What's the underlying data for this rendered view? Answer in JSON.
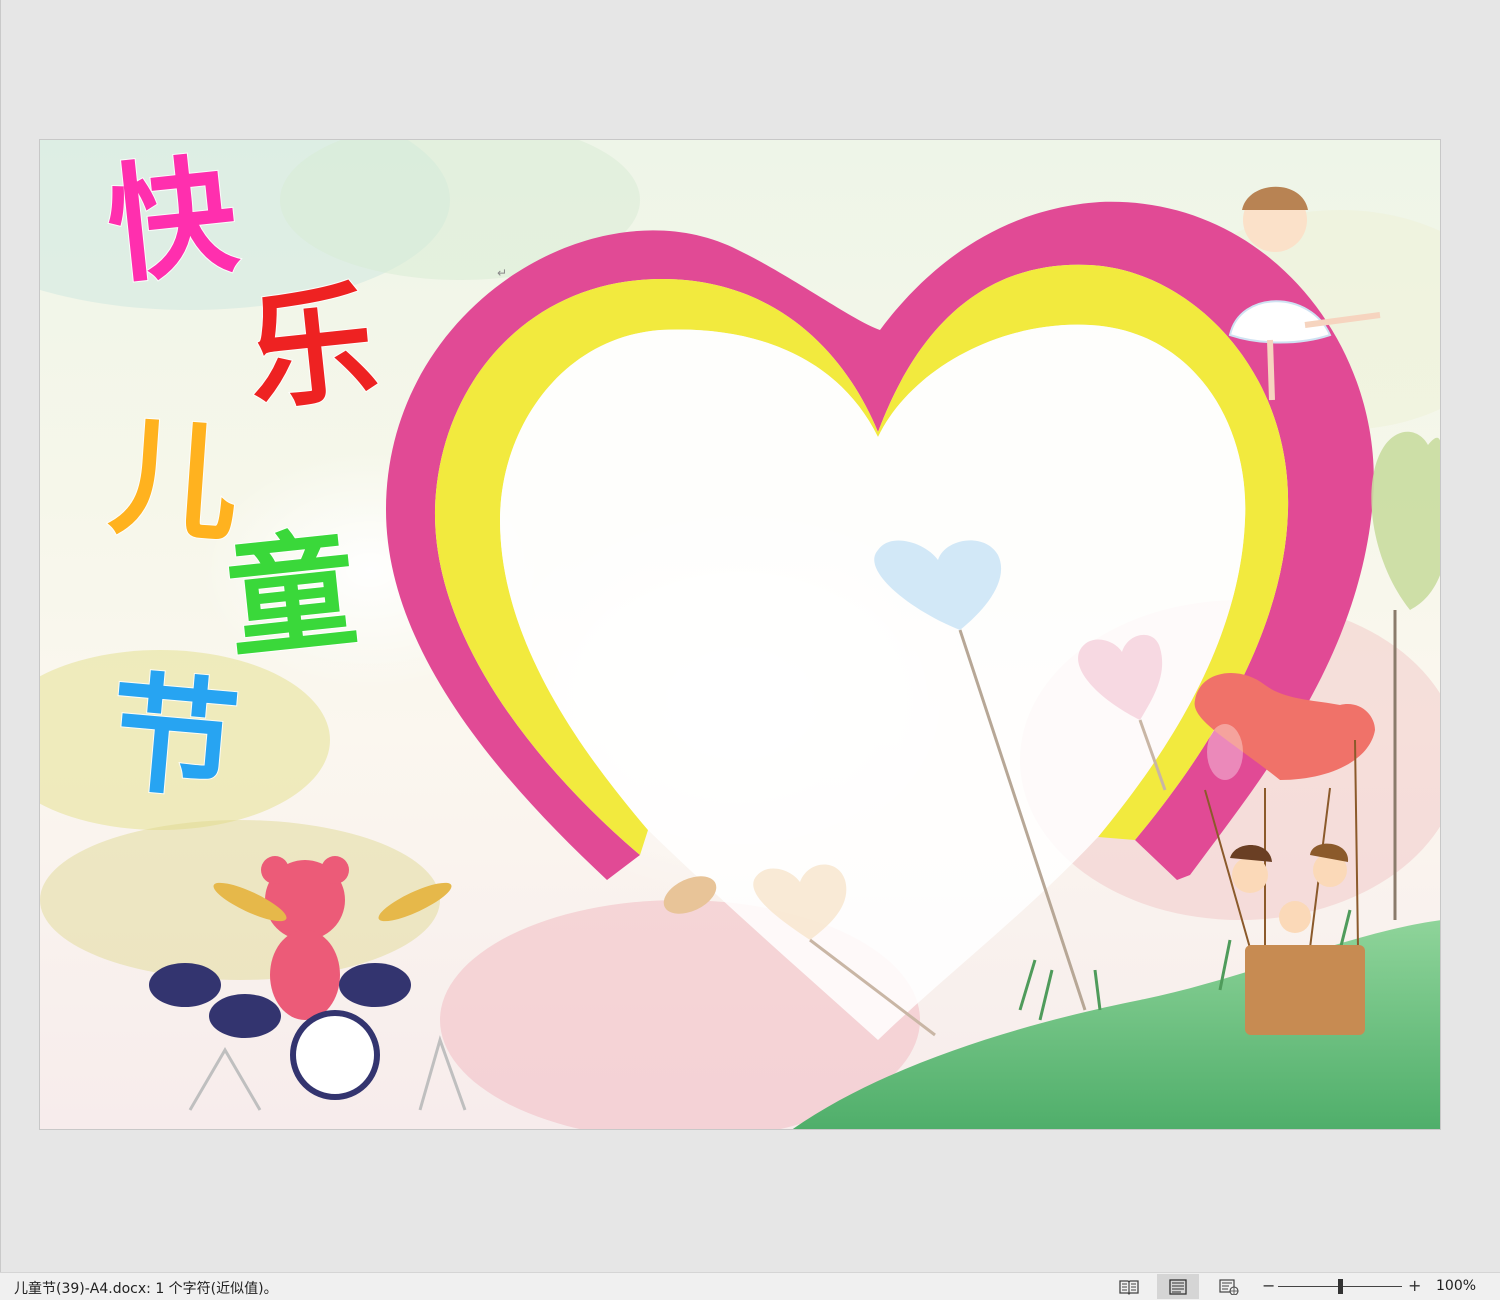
{
  "document": {
    "title_chars": [
      "快",
      "乐",
      "儿",
      "童",
      "节"
    ],
    "paragraph_mark": "↵"
  },
  "status_bar": {
    "text": "儿童节(39)-A4.docx: 1 个字符(近似值)。",
    "zoom_minus": "−",
    "zoom_plus": "+",
    "zoom_level": "100%"
  },
  "colors": {
    "heart_outer": "#e14a95",
    "heart_inner": "#f2ea3e",
    "char_kuai": "#ff2fae",
    "char_le": "#ee2222",
    "char_er": "#ffb21f",
    "char_tong": "#3ad83a",
    "char_jie": "#27a4f2"
  }
}
